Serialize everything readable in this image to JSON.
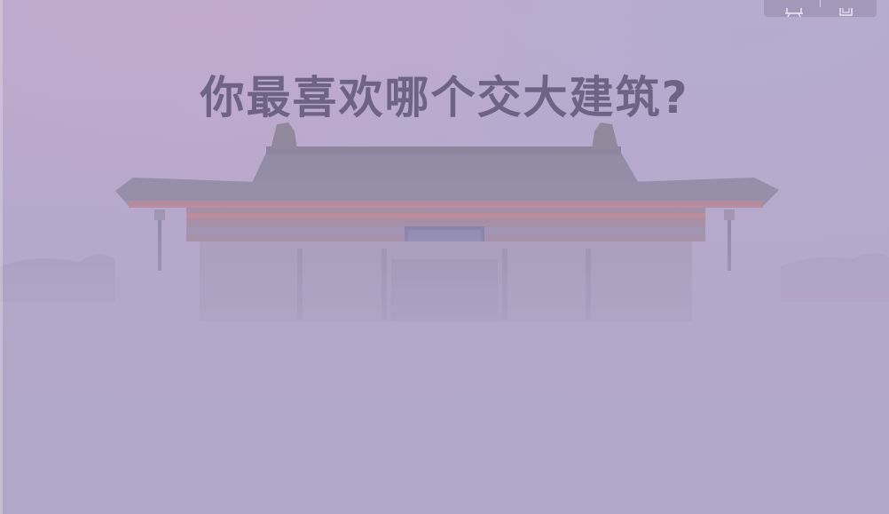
{
  "slide": {
    "title": "你最喜欢哪个交大建筑?"
  },
  "toolbar": {
    "icons": [
      "present-icon",
      "copy-icon"
    ]
  },
  "colors": {
    "background": "#b5a8c9",
    "title": "#6e6383",
    "roof": "#8f8aa3",
    "beam_red": "#c27a86"
  }
}
